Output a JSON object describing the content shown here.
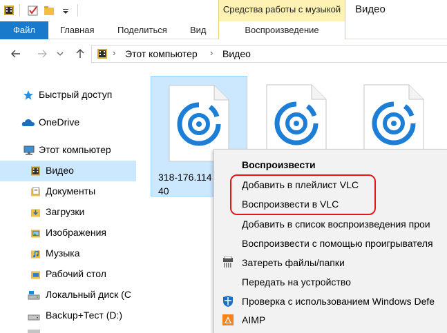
{
  "ribbon": {
    "music_tools_label": "Средства работы с музыкой",
    "window_title": "Видео",
    "tab_file": "Файл",
    "tab_home": "Главная",
    "tab_share": "Поделиться",
    "tab_view": "Вид",
    "tab_playback": "Воспроизведение"
  },
  "address": {
    "crumbs": [
      "Этот компьютер",
      "Видео"
    ]
  },
  "navpane": {
    "items": [
      {
        "label": "Быстрый доступ",
        "icon": "star-icon"
      },
      {
        "label": "OneDrive",
        "icon": "cloud-icon"
      },
      {
        "label": "Этот компьютер",
        "icon": "computer-icon"
      },
      {
        "label": "Видео",
        "icon": "video-folder-icon"
      },
      {
        "label": "Документы",
        "icon": "documents-folder-icon"
      },
      {
        "label": "Загрузки",
        "icon": "downloads-folder-icon"
      },
      {
        "label": "Изображения",
        "icon": "pictures-folder-icon"
      },
      {
        "label": "Музыка",
        "icon": "music-folder-icon"
      },
      {
        "label": "Рабочий стол",
        "icon": "desktop-folder-icon"
      },
      {
        "label": "Локальный диск (C",
        "icon": "local-disk-icon"
      },
      {
        "label": "Backup+Тест (D:)",
        "icon": "drive-icon"
      }
    ]
  },
  "files": [
    {
      "name": "318-176.114\n40",
      "icon": "media-file-icon"
    },
    {
      "name": "",
      "icon": "media-file-icon"
    },
    {
      "name": "",
      "icon": "media-file-icon"
    }
  ],
  "context_menu": {
    "items": [
      {
        "label": "Воспроизвести"
      },
      {
        "label": "Добавить в плейлист VLC"
      },
      {
        "label": "Воспроизвести в VLC"
      },
      {
        "label": "Добавить в список воспроизведения прои"
      },
      {
        "label": "Воспроизвести с помощью проигрывателя"
      },
      {
        "label": "Затереть файлы/папки"
      },
      {
        "label": "Передать на устройство"
      },
      {
        "label": "Проверка с использованием Windows Defe"
      },
      {
        "label": "AIMP"
      }
    ]
  },
  "colors": {
    "accent": "#1979ca",
    "selection": "#cce8ff",
    "music_tools_bg": "#fdf2b3",
    "annotation_red": "#e8141c",
    "media_icon_blue": "#1c7ed6"
  }
}
